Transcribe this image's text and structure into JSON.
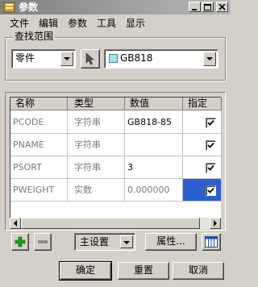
{
  "window": {
    "title": "参数"
  },
  "menu": [
    "文件",
    "编辑",
    "参数",
    "工具",
    "显示"
  ],
  "search_group": {
    "label": "查找范围",
    "scope_select": "零件",
    "standard_select": "GB818"
  },
  "table": {
    "columns": [
      "名称",
      "类型",
      "数值",
      "指定"
    ],
    "rows": [
      {
        "name": "PCODE",
        "type": "字符串",
        "value": "GB818-85",
        "specified": true,
        "value_grey": false,
        "type_grey": true
      },
      {
        "name": "PNAME",
        "type": "字符串",
        "value": "",
        "specified": true,
        "value_grey": false,
        "type_grey": true
      },
      {
        "name": "PSORT",
        "type": "字符串",
        "value": "3",
        "specified": true,
        "value_grey": false,
        "type_grey": true
      },
      {
        "name": "PWEIGHT",
        "type": "实数",
        "value": "0.000000",
        "specified": true,
        "value_grey": true,
        "type_grey": true,
        "selected": true
      }
    ]
  },
  "toolbar": {
    "settings_select": "主设置",
    "properties_label": "属性..."
  },
  "footer": {
    "ok_label": "确定",
    "reset_label": "重置",
    "cancel_label": "取消"
  },
  "colors": {
    "add": "#1a9a1a",
    "selection": "#2b5fce"
  }
}
